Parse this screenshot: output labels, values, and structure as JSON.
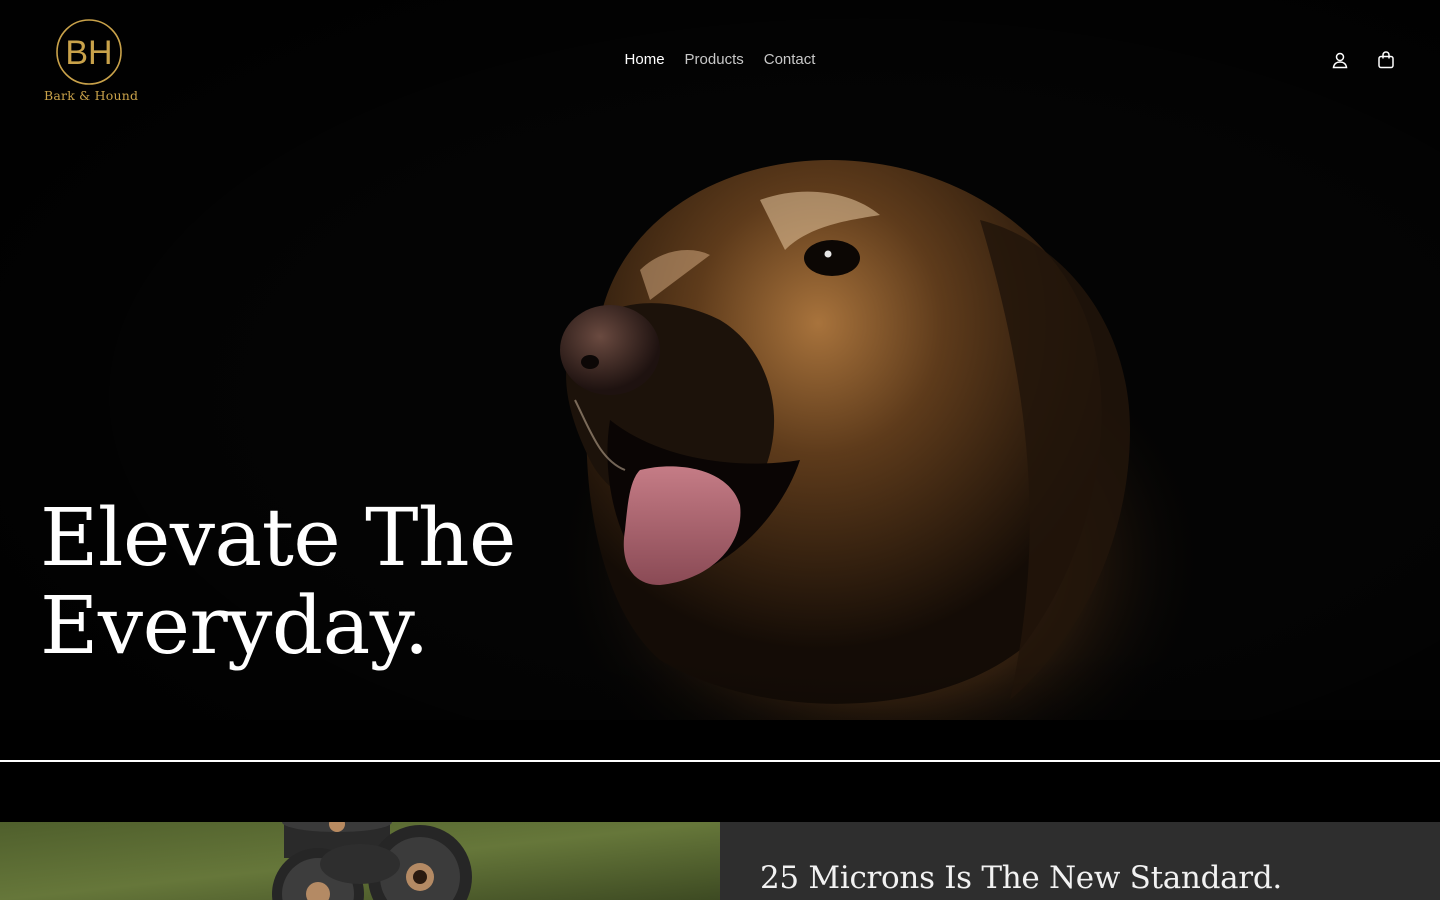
{
  "brand": {
    "monogram": "BH",
    "name": "Bark & Hound",
    "accent_color": "#c9a24a"
  },
  "nav": {
    "items": [
      {
        "label": "Home",
        "active": true
      },
      {
        "label": "Products",
        "active": false
      },
      {
        "label": "Contact",
        "active": false
      }
    ]
  },
  "header_icons": [
    "account-icon",
    "cart-icon"
  ],
  "hero": {
    "title_line1": "Elevate The",
    "title_line2": "Everyday.",
    "image": "golden-retriever-portrait"
  },
  "feature": {
    "heading": "25 Microns Is The New Standard.",
    "image": "waste-bag-rolls",
    "panel_color": "#2e2e2e"
  }
}
